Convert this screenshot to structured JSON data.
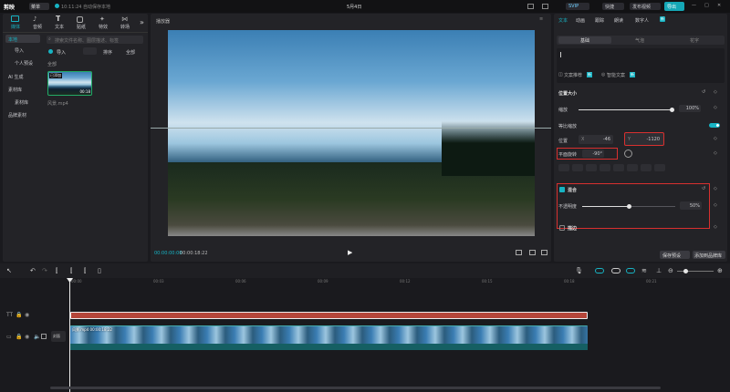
{
  "app": {
    "logo": "剪映",
    "menu": "菜单",
    "autosave": "10:11:24 自动保存本地",
    "project_title": "5月4日"
  },
  "top_right": {
    "svip": "SVIP",
    "shortcut": "快捷",
    "publish": "发布视频",
    "export": "导出"
  },
  "media_tabs": [
    "媒体",
    "音频",
    "文本",
    "贴纸",
    "特效",
    "转场"
  ],
  "media_sidebar": [
    "本地",
    "导入",
    "个人预设",
    "AI 生成",
    "素材库",
    "素材库",
    "品牌素材"
  ],
  "media_search_placeholder": "搜索文件名称、图层描述、标签",
  "import_bar": {
    "import": "导入",
    "sort": "排序",
    "all": "全部"
  },
  "media_section_all": "全部",
  "clip": {
    "badge": "已添加",
    "duration": "00:18",
    "name": "风景.mp4"
  },
  "player": {
    "title": "播放器",
    "time_current": "00:00:00:00",
    "time_total": "00:00:18:22"
  },
  "right_tabs": [
    "文本",
    "动画",
    "跟踪",
    "朗读",
    "数字人"
  ],
  "right_tabs_badge": "新",
  "sub_tabs": [
    "基础",
    "气泡",
    "花字"
  ],
  "text_tools": {
    "left": "文案推荐",
    "right": "智能文案",
    "badge": "新"
  },
  "props": {
    "position_size": "位置大小",
    "scale_label": "缩放",
    "scale_value": "100%",
    "scale_level": 1.0,
    "uniform_scale": "等比缩放",
    "position_label": "位置",
    "x_axis": "X",
    "x_value": "-46",
    "y_axis": "Y",
    "y_value": "-1120",
    "rotation_label": "平面旋转",
    "rotation_value": "-90°",
    "blend_label": "混合",
    "opacity_label": "不透明度",
    "opacity_value": "50%",
    "opacity_level": 0.5,
    "stroke_label": "描边"
  },
  "bottom_buttons": {
    "save_preset": "保存预设",
    "add_brand": "添加到品牌库"
  },
  "timeline": {
    "ruler": [
      "00:00",
      "00:03",
      "00:06",
      "00:09",
      "00:12",
      "00:15",
      "00:18",
      "00:21"
    ],
    "video_clip_label": "风景.mp4  00:00:18:22",
    "cover_label": "封面"
  },
  "colors": {
    "accent": "#17b3c3",
    "text_clip": "#b5463a",
    "export": "#15a7b6",
    "highlight_box": "#d8302f"
  }
}
